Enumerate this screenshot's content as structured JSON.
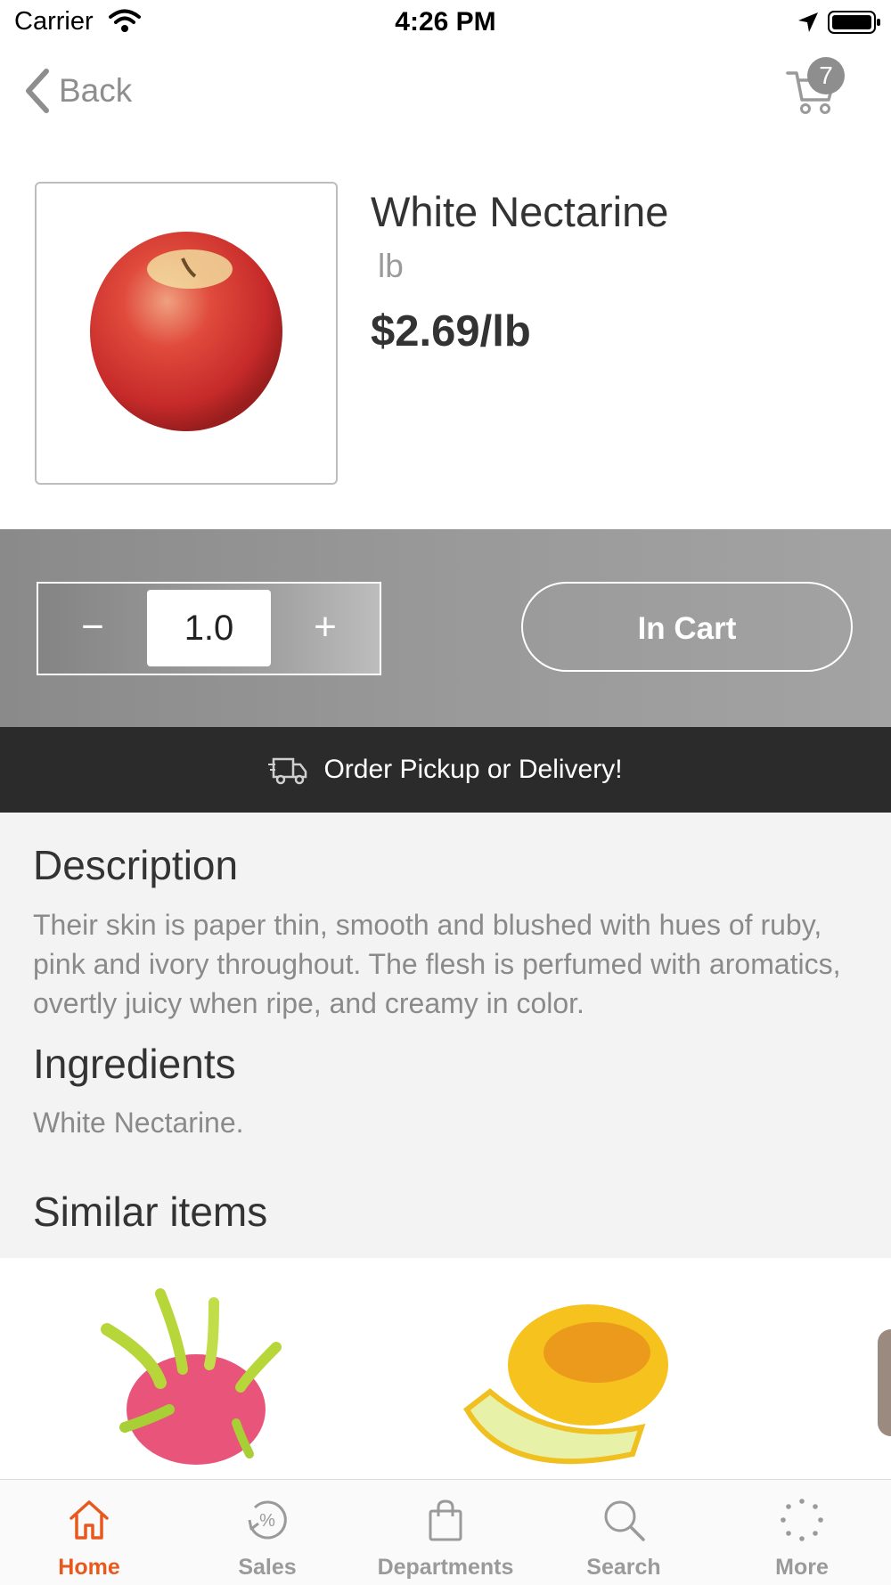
{
  "status_bar": {
    "carrier": "Carrier",
    "time": "4:26 PM"
  },
  "nav": {
    "back_label": "Back",
    "cart_count": "7"
  },
  "product": {
    "name": "White Nectarine",
    "unit": "lb",
    "price": "$2.69/lb"
  },
  "quantity": {
    "value": "1.0",
    "minus_symbol": "−",
    "plus_symbol": "+"
  },
  "cart_button": {
    "label": "In Cart"
  },
  "banner": {
    "text": "Order Pickup or Delivery!"
  },
  "description": {
    "heading": "Description",
    "text": "Their skin is paper thin, smooth and blushed with hues of ruby, pink and ivory throughout. The flesh is perfumed with aromatics, overtly juicy when ripe, and creamy in color."
  },
  "ingredients": {
    "heading": "Ingredients",
    "text": "White Nectarine."
  },
  "similar": {
    "heading": "Similar items"
  },
  "tabs": [
    {
      "label": "Home",
      "icon": "home-icon",
      "active": true
    },
    {
      "label": "Sales",
      "icon": "sales-icon",
      "active": false
    },
    {
      "label": "Departments",
      "icon": "bag-icon",
      "active": false
    },
    {
      "label": "Search",
      "icon": "search-icon",
      "active": false
    },
    {
      "label": "More",
      "icon": "more-icon",
      "active": false
    }
  ],
  "colors": {
    "accent": "#e8591e",
    "band": "#999999",
    "banner": "#2b2b2b",
    "section_bg": "#f3f3f3"
  }
}
